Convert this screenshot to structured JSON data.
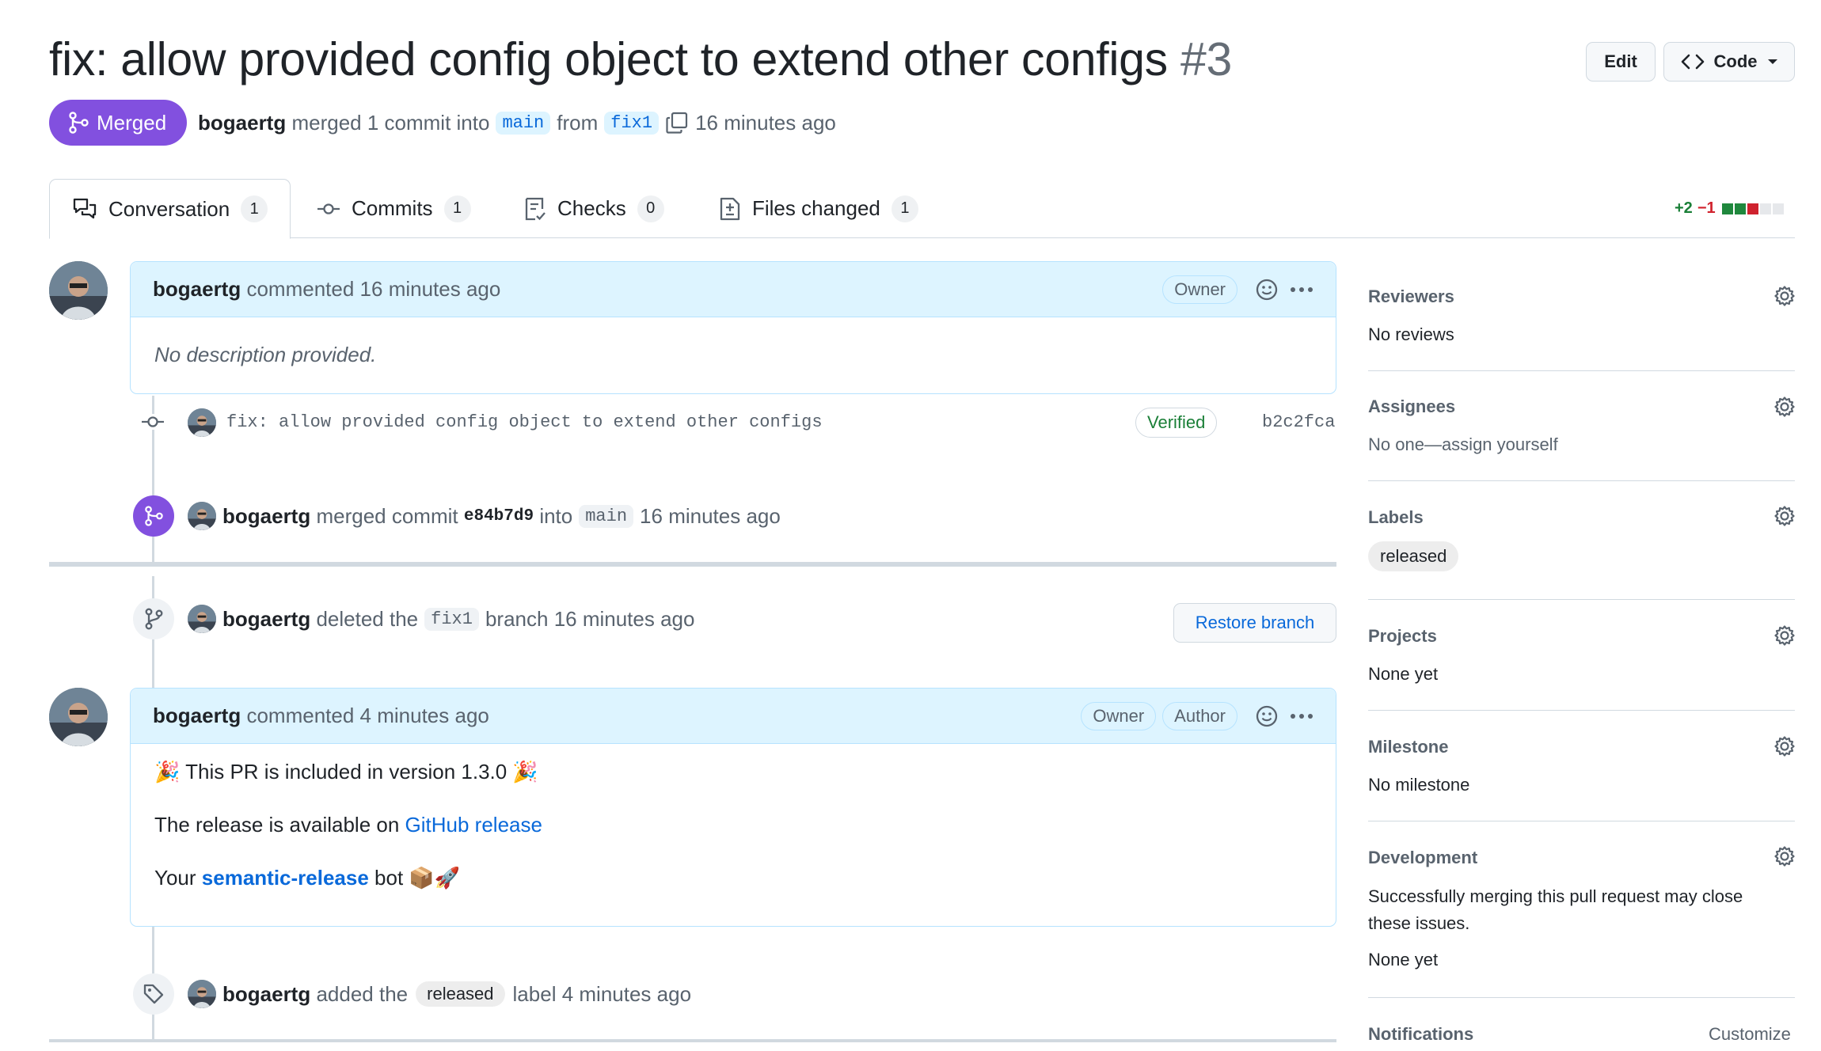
{
  "header": {
    "title": "fix: allow provided config object to extend other configs",
    "number": "#3",
    "edit_label": "Edit",
    "code_label": "Code",
    "status": "Merged",
    "author": "bogaertg",
    "merged_text": "merged 1 commit into",
    "base_branch": "main",
    "from_text": "from",
    "head_branch": "fix1",
    "time": "16 minutes ago"
  },
  "tabs": [
    {
      "label": "Conversation",
      "count": "1"
    },
    {
      "label": "Commits",
      "count": "1"
    },
    {
      "label": "Checks",
      "count": "0"
    },
    {
      "label": "Files changed",
      "count": "1"
    }
  ],
  "diffstat": {
    "additions": "+2",
    "deletions": "−1"
  },
  "timeline": {
    "comment1": {
      "author": "bogaertg",
      "action": "commented",
      "time": "16 minutes ago",
      "role": "Owner",
      "body": "No description provided."
    },
    "commit": {
      "message": "fix: allow provided config object to extend other configs",
      "verified": "Verified",
      "sha": "b2c2fca"
    },
    "merge_event": {
      "author": "bogaertg",
      "text1": "merged commit",
      "sha": "e84b7d9",
      "text2": "into",
      "branch": "main",
      "time": "16 minutes ago"
    },
    "delete_event": {
      "author": "bogaertg",
      "text1": "deleted the",
      "branch": "fix1",
      "text2": "branch",
      "time": "16 minutes ago",
      "button": "Restore branch"
    },
    "comment2": {
      "author": "bogaertg",
      "action": "commented",
      "time": "4 minutes ago",
      "role1": "Owner",
      "role2": "Author",
      "line1": "🎉 This PR is included in version 1.3.0 🎉",
      "line2_prefix": "The release is available on",
      "line2_link": "GitHub release",
      "line3_prefix": "Your",
      "line3_link": "semantic-release",
      "line3_suffix": "bot 📦🚀"
    },
    "label_event": {
      "author": "bogaertg",
      "text1": "added the",
      "label": "released",
      "text2": "label",
      "time": "4 minutes ago"
    }
  },
  "sidebar": {
    "reviewers": {
      "title": "Reviewers",
      "value": "No reviews"
    },
    "assignees": {
      "title": "Assignees",
      "value": "No one—assign yourself"
    },
    "labels": {
      "title": "Labels",
      "value": "released"
    },
    "projects": {
      "title": "Projects",
      "value": "None yet"
    },
    "milestone": {
      "title": "Milestone",
      "value": "No milestone"
    },
    "development": {
      "title": "Development",
      "desc": "Successfully merging this pull request may close these issues.",
      "value": "None yet"
    },
    "notifications": {
      "title": "Notifications",
      "action": "Customize"
    }
  }
}
